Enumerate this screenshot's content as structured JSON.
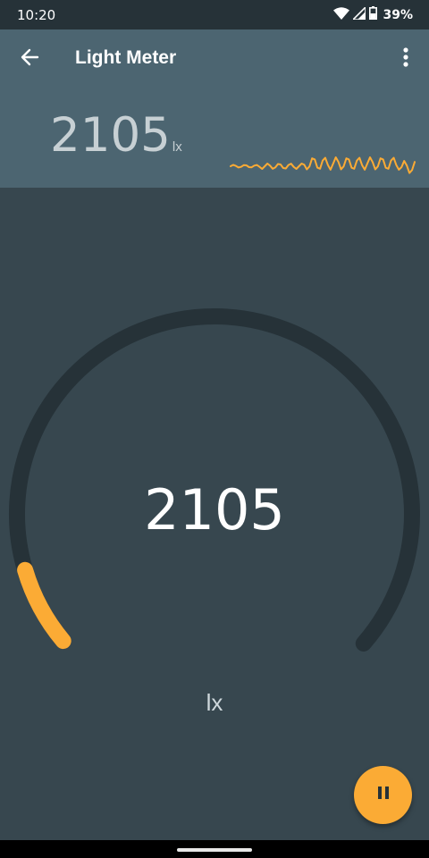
{
  "status_bar": {
    "time": "10:20",
    "battery_text": "39%",
    "icons": [
      "wifi-icon",
      "signal-icon",
      "battery-icon"
    ]
  },
  "app_bar": {
    "title": "Light Meter",
    "back_icon": "arrow-back-icon",
    "menu_icon": "more-vert-icon",
    "reading_value": "2105",
    "reading_unit": "lx"
  },
  "gauge": {
    "value": "2105",
    "unit": "lx",
    "fill_fraction": 0.09
  },
  "fab": {
    "icon": "pause-icon"
  },
  "colors": {
    "status_bar_bg": "#263238",
    "app_bar_bg": "#4c6571",
    "background": "#37474f",
    "gauge_track": "#263238",
    "accent": "#fbab35"
  }
}
